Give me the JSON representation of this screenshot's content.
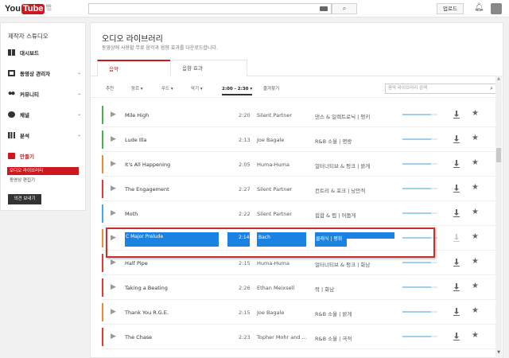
{
  "header": {
    "logo_you": "You",
    "logo_tube": "Tube",
    "logo_region": "KR",
    "search_placeholder": "",
    "upload_label": "업로드"
  },
  "sidebar": {
    "title": "제작자 스튜디오",
    "items": [
      {
        "label": "대시보드",
        "icon": "dashboard-icon"
      },
      {
        "label": "동영상 관리자",
        "icon": "video-manager-icon"
      },
      {
        "label": "커뮤니티",
        "icon": "community-icon"
      },
      {
        "label": "채널",
        "icon": "channel-icon"
      },
      {
        "label": "분석",
        "icon": "analytics-icon"
      },
      {
        "label": "만들기",
        "icon": "create-icon"
      }
    ],
    "subitems": [
      {
        "label": "오디오 라이브러리",
        "selected": true
      },
      {
        "label": "동영상 편집기",
        "selected": false
      }
    ],
    "feedback_label": "의견 보내기"
  },
  "main": {
    "title": "오디오 라이브러리",
    "description": "동영상에 사용할 무료 음악과 음향 효과를 다운로드합니다.",
    "tabs": [
      {
        "label": "음악",
        "active": true
      },
      {
        "label": "음향 효과",
        "active": false
      }
    ],
    "filters": [
      {
        "label": "추천",
        "arrow": false
      },
      {
        "label": "장르 ▾",
        "arrow": true
      },
      {
        "label": "무드 ▾",
        "arrow": true
      },
      {
        "label": "악기 ▾",
        "arrow": true
      },
      {
        "label": "2:00 - 2:30 ▾",
        "arrow": true,
        "selected": true
      },
      {
        "label": "즐겨찾기",
        "arrow": false
      }
    ],
    "search_placeholder": "음악 라이브러리 검색"
  },
  "tracks": [
    {
      "title": "Mile High",
      "duration": "2:20",
      "artist": "Silent Partner",
      "genre": "댄스 & 일렉트로닉 | 펑키",
      "color": "#4caf50"
    },
    {
      "title": "Lude Illa",
      "duration": "2:13",
      "artist": "Joe Bagale",
      "genre": "R&B 소울 | 명랑",
      "color": "#4caf50"
    },
    {
      "title": "It's All Happening",
      "duration": "2:05",
      "artist": "Huma-Huma",
      "genre": "얼터너티브 & 펑크 | 밝게",
      "color": "#ef8a34"
    },
    {
      "title": "The Engagement",
      "duration": "2:27",
      "artist": "Silent Partner",
      "genre": "컨트리 & 포크 | 낭만적",
      "color": "#e53935"
    },
    {
      "title": "Moth",
      "duration": "2:22",
      "artist": "Silent Partner",
      "genre": "힙합 & 랩 | 어둡게",
      "color": "#42a5f5"
    },
    {
      "title": "C Major Prelude",
      "duration": "2:14",
      "artist": "Bach",
      "genre": "클래식 | 평화",
      "color": "#ef8a34",
      "highlighted": true
    },
    {
      "title": "Half Pipe",
      "duration": "2:15",
      "artist": "Huma-Huma",
      "genre": "얼터너티브 & 펑크 | 화남",
      "color": "#e53935"
    },
    {
      "title": "Taking a Beating",
      "duration": "2:26",
      "artist": "Ethan Meixsell",
      "genre": "락 | 화남",
      "color": "#e53935"
    },
    {
      "title": "Thank You R.G.E.",
      "duration": "2:15",
      "artist": "Joe Bagale",
      "genre": "R&B 소울 | 밝게",
      "color": "#ef8a34"
    },
    {
      "title": "The Chase",
      "duration": "2:23",
      "artist": "Topher Mohr and ...",
      "genre": "R&B 소울 | 극적",
      "color": "#e53935"
    }
  ]
}
